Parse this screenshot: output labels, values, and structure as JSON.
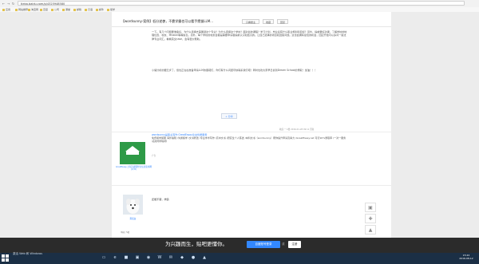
{
  "browser": {
    "url": "tieba.baidu.com/p/4325948580",
    "back_icon": "back-arrow-icon",
    "forward_icon": "forward-arrow-icon",
    "refresh_icon": "refresh-icon",
    "bookmarks": [
      "应用",
      "网站推荐",
      "淘宝网",
      "百度",
      "公司",
      "课堂",
      "邮箱",
      "日语",
      "邮件",
      "留学"
    ]
  },
  "post": {
    "title": "【wordsunny-案例】低分逆袭，不靠学霸也可以看手攒拔LLM...",
    "toolbar": {
      "watch_label": "只看楼主",
      "collect_label": "收藏",
      "reply_label": "回复"
    },
    "paragraph1": "一下。有几个问题要准备好，为什么选择去美国读这个专业？为什么选择这个学校？面对最的课程？学习计划，毕业后有什么职业规划和目标？另外，提前要好功课，了解学校的地理位置、校友、Mission等等信息。另外，每个学校的校友会都是需要申请者提前认识和结识的。让自己选择的项目和回答问题。这也会拥有最佳的机会，回应开始可以多问一些法律专业问汇。看看英文case，会有很大帮助。",
    "paragraph2": "小编分析的要乏步了，但也正在在准备申请LLM的童鞋们，你们有什么问题尽快联系我们吧！同时也欢大家早日拿到Dream School的录取！加油！！！",
    "share_label": "分享",
    "meta": "收起 ^ 1楼 2016-01-28 09:11 回复"
  },
  "ad": {
    "author": "GradEssay上海英语服务生信息读书网(公众)",
    "title": "wordsunny是职业写作 GreatEssay论文优质服务",
    "body": "免费留学留服 海外编辑 /沟通留学 /文书修改 /专业学术写作 /高中文书 /研究生个人陈述 /本科文书（wordsunny）帮你提升申请竞争力 /GreatEssay.net 可打90%录取率 /一对一服务 /名校导师指导",
    "tag": "广告"
  },
  "reply2": {
    "text": "还能不错，学霸",
    "username": "雨夜白",
    "level": "举报 | 5楼"
  },
  "right_tools": [
    "share-tool-icon",
    "add-tool-icon",
    "top-tool-icon",
    "text-tool-icon"
  ],
  "banner": {
    "text": "为兴趣而生，贴吧更懂你。",
    "login_label": "百度账号登录",
    "or_label": "或",
    "register_label": "注册"
  },
  "taskbar": {
    "watermark": "激活 Web 和 Windows",
    "time": "15:22",
    "date": "2016-08-12"
  }
}
